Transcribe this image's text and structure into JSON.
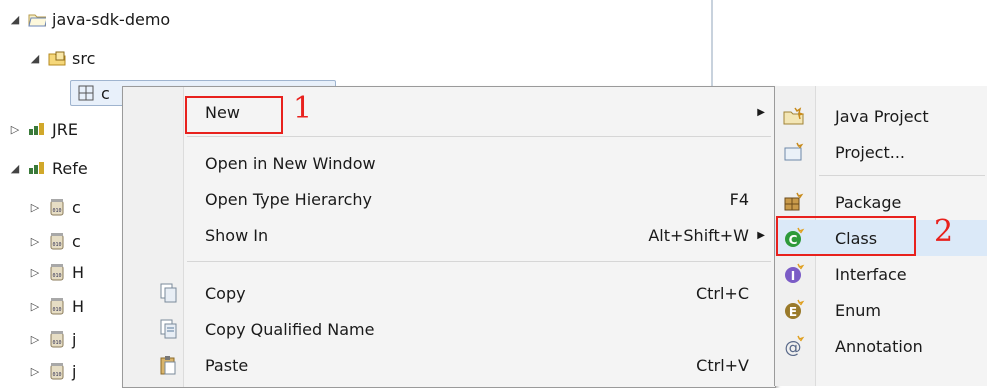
{
  "tree": {
    "project": "java-sdk-demo",
    "src": "src",
    "package_partial": "c",
    "jre_partial": "JRE",
    "refs_partial": "Refe",
    "jars_partial": [
      "c",
      "c",
      "H",
      "H",
      "j",
      "j"
    ]
  },
  "menu": {
    "items": [
      {
        "label": "New",
        "shortcut": "",
        "arrow": "▶"
      },
      {
        "label": "Open in New Window",
        "shortcut": ""
      },
      {
        "label": "Open Type Hierarchy",
        "shortcut": "F4"
      },
      {
        "label": "Show In",
        "shortcut": "Alt+Shift+W",
        "arrow": "▶"
      },
      {
        "label": "Copy",
        "shortcut": "Ctrl+C"
      },
      {
        "label": "Copy Qualified Name",
        "shortcut": ""
      },
      {
        "label": "Paste",
        "shortcut": "Ctrl+V"
      }
    ]
  },
  "submenu": {
    "items": [
      {
        "label": "Java Project",
        "icon": "java-project-icon"
      },
      {
        "label": "Project...",
        "icon": "project-icon"
      },
      {
        "label": "Package",
        "icon": "package-icon"
      },
      {
        "label": "Class",
        "icon": "class-icon"
      },
      {
        "label": "Interface",
        "icon": "interface-icon"
      },
      {
        "label": "Enum",
        "icon": "enum-icon"
      },
      {
        "label": "Annotation",
        "icon": "annotation-icon"
      }
    ]
  },
  "annotations": {
    "step1": "1",
    "step2": "2"
  },
  "colors": {
    "annotation_red": "#e8211d",
    "highlight": "#dbe9f8"
  }
}
